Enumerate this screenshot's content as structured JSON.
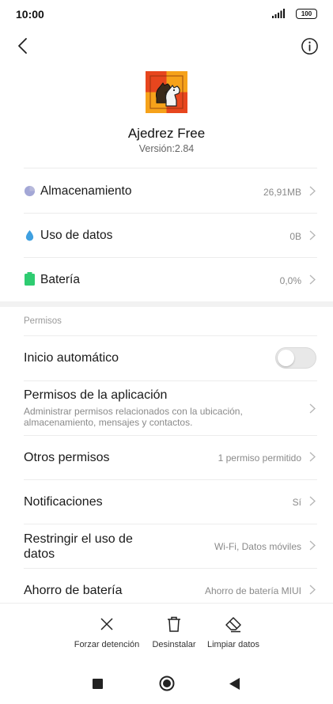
{
  "status": {
    "time": "10:00",
    "battery": "100"
  },
  "app": {
    "name": "Ajedrez Free",
    "version": "Versión:2.84"
  },
  "summary_rows": [
    {
      "label": "Almacenamiento",
      "value": "26,91MB",
      "icon": "storage-pie-icon",
      "color": "#8a8fc6"
    },
    {
      "label": "Uso de datos",
      "value": "0B",
      "icon": "data-drop-icon",
      "color": "#3fa0e0"
    },
    {
      "label": "Batería",
      "value": "0,0%",
      "icon": "battery-icon",
      "color": "#2ecc71"
    }
  ],
  "permissions": {
    "section_label": "Permisos",
    "autostart": {
      "label": "Inicio automático",
      "enabled": false
    },
    "app_permissions": {
      "label": "Permisos de la aplicación",
      "subtitle": "Administrar permisos relacionados con la ubicación, almacenamiento, mensajes y contactos."
    },
    "other_permissions": {
      "label": "Otros permisos",
      "value": "1 permiso permitido"
    },
    "notifications": {
      "label": "Notificaciones",
      "value": "Sí"
    },
    "restrict_data": {
      "label_line1": "Restringir el uso de",
      "label_line2": "datos",
      "value": "Wi-Fi, Datos móviles"
    },
    "battery_saver": {
      "label": "Ahorro de batería",
      "value": "Ahorro de batería MIUI"
    }
  },
  "actions": {
    "force_stop": "Forzar detención",
    "uninstall": "Desinstalar",
    "clear_data": "Limpiar datos"
  }
}
